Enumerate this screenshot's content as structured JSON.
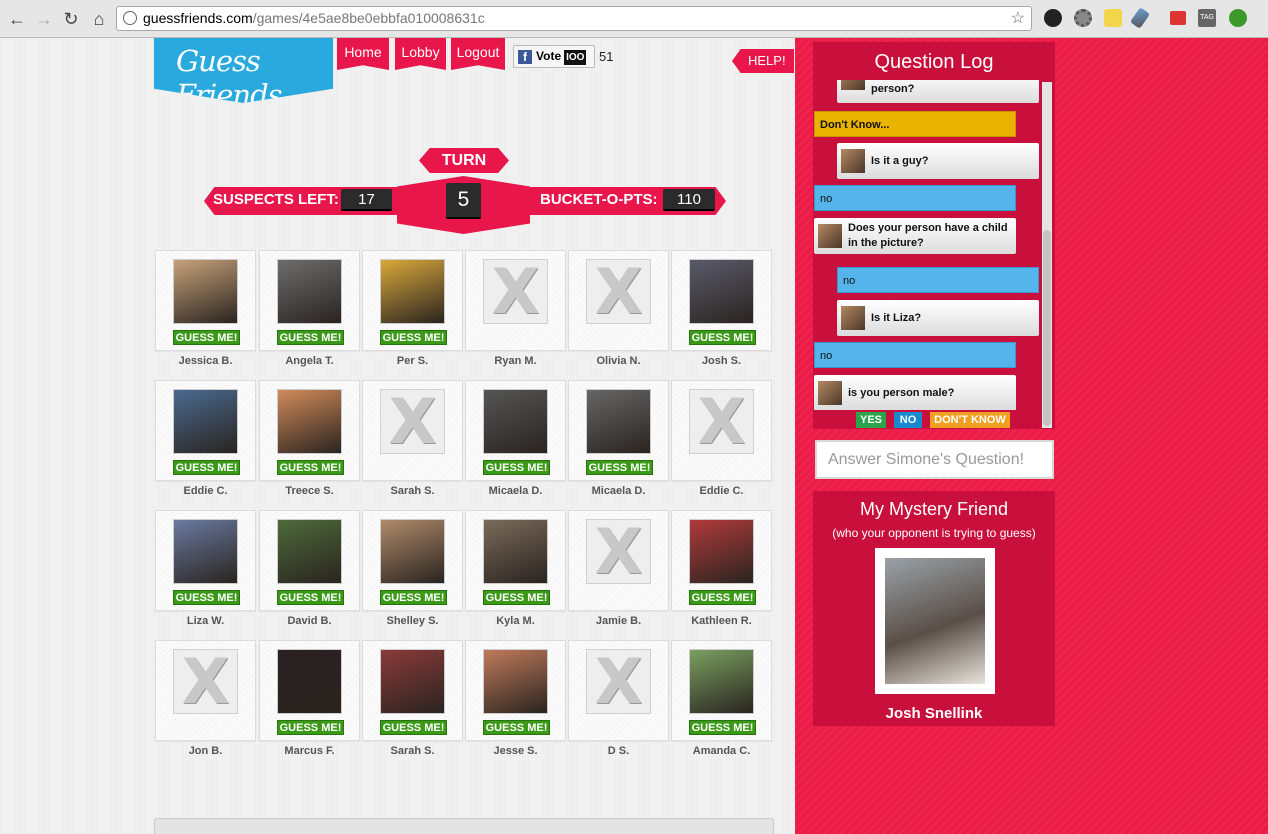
{
  "browser": {
    "url_host": "guessfriends.com",
    "url_path": "/games/4e5ae8be0ebbfa010008631c",
    "ext_icons": [
      "github-icon",
      "settings-icon",
      "notes-icon",
      "dropper-icon",
      "clip-icon",
      "tag-icon",
      "shield-icon"
    ]
  },
  "site": {
    "logo": "Guess Friends",
    "nav": [
      "Home",
      "Lobby",
      "Logout"
    ],
    "vote_label": "Vote",
    "vote_box": "IOO",
    "vote_count": "51",
    "help": "HELP!"
  },
  "scoreboard": {
    "turn_label": "TURN",
    "turn": "5",
    "suspects_label": "SUSPECTS LEFT:",
    "suspects": "17",
    "bucket_label": "BUCKET-O-PTS:",
    "bucket": "110"
  },
  "guess_label": "GUESS ME!",
  "suspects": [
    {
      "name": "Jessica B.",
      "eliminated": false
    },
    {
      "name": "Angela T.",
      "eliminated": false
    },
    {
      "name": "Per S.",
      "eliminated": false
    },
    {
      "name": "Ryan M.",
      "eliminated": true
    },
    {
      "name": "Olivia N.",
      "eliminated": true
    },
    {
      "name": "Josh S.",
      "eliminated": false
    },
    {
      "name": "Eddie C.",
      "eliminated": false
    },
    {
      "name": "Treece S.",
      "eliminated": false
    },
    {
      "name": "Sarah S.",
      "eliminated": true
    },
    {
      "name": "Micaela D.",
      "eliminated": false
    },
    {
      "name": "Micaela D.",
      "eliminated": false
    },
    {
      "name": "Eddie C.",
      "eliminated": true
    },
    {
      "name": "Liza W.",
      "eliminated": false
    },
    {
      "name": "David B.",
      "eliminated": false
    },
    {
      "name": "Shelley S.",
      "eliminated": false
    },
    {
      "name": "Kyla M.",
      "eliminated": false
    },
    {
      "name": "Jamie B.",
      "eliminated": true
    },
    {
      "name": "Kathleen R.",
      "eliminated": false
    },
    {
      "name": "Jon B.",
      "eliminated": true
    },
    {
      "name": "Marcus F.",
      "eliminated": false
    },
    {
      "name": "Sarah S.",
      "eliminated": false
    },
    {
      "name": "Jesse S.",
      "eliminated": false
    },
    {
      "name": "D S.",
      "eliminated": true
    },
    {
      "name": "Amanda C.",
      "eliminated": false
    }
  ],
  "question_log": {
    "title": "Question Log",
    "entries": [
      {
        "kind": "question",
        "text": "person?"
      },
      {
        "kind": "answer",
        "color": "gold",
        "text": "Don't Know..."
      },
      {
        "kind": "question",
        "text": "Is it a guy?"
      },
      {
        "kind": "answer",
        "color": "blue",
        "text": "no"
      },
      {
        "kind": "question",
        "text": "Does your person have a child in the picture?"
      },
      {
        "kind": "answer",
        "color": "blue",
        "text": "no"
      },
      {
        "kind": "question",
        "text": "Is it Liza?"
      },
      {
        "kind": "answer",
        "color": "blue",
        "text": "no"
      },
      {
        "kind": "question",
        "text": "is you person male?"
      }
    ],
    "buttons": {
      "yes": "YES",
      "no": "NO",
      "dont_know": "DON'T KNOW"
    }
  },
  "answer_placeholder": "Answer Simone's Question!",
  "mystery": {
    "title": "My Mystery Friend",
    "subtitle": "(who your opponent is trying to guess)",
    "name": "Josh Snellink"
  },
  "colors": {
    "brand_red": "#e8164a",
    "sidebar_red": "#ec1b47",
    "logo_blue": "#29a9dd",
    "guess_green": "#3a9a18",
    "answer_blue": "#55b4ea",
    "answer_gold": "#e9b300"
  }
}
